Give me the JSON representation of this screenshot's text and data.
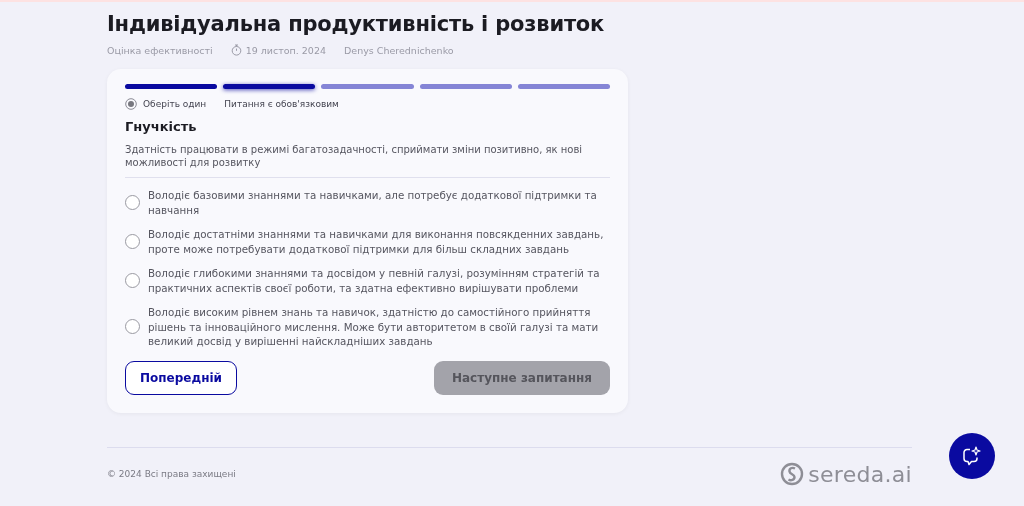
{
  "header": {
    "title": "Індивідуальна продуктивність і розвиток",
    "meta": {
      "category": "Оцінка ефективності",
      "date": "19 листоп. 2024",
      "author": "Denys Cherednichenko"
    }
  },
  "card": {
    "steps": [
      {
        "kind": "complete"
      },
      {
        "kind": "current"
      },
      {
        "kind": "upcoming"
      },
      {
        "kind": "upcoming"
      },
      {
        "kind": "upcoming"
      }
    ],
    "hint": "Оберіть один",
    "required_note": "Питання є обов'язковим",
    "question": {
      "title": "Гнучкість",
      "description": "Здатність працювати в режимі багатозадачності, сприймати зміни позитивно, як нові можливості для розвитку"
    },
    "options": [
      {
        "label": "Володіє базовими знаннями та навичками, але потребує додаткової підтримки та навчання",
        "selected": false
      },
      {
        "label": "Володіє достатніми знаннями та навичками для виконання повсякденних завдань, проте може потребувати додаткової підтримки для більш складних завдань",
        "selected": false
      },
      {
        "label": "Володіє глибокими знаннями та досвідом у певній галузі, розумінням стратегій та практичних аспектів своєї роботи, та здатна ефективно вирішувати проблеми",
        "selected": false
      },
      {
        "label": "Володіє високим рівнем знань та навичок, здатністю до самостійного прийняття рішень та інноваційного мислення. Може бути авторитетом в своїй галузі та мати великий досвід у вирішенні найскладніших завдань",
        "selected": false
      }
    ],
    "buttons": {
      "previous": {
        "label": "Попередній",
        "disabled": false
      },
      "next": {
        "label": "Наступне запитання",
        "disabled": true
      }
    }
  },
  "footer": {
    "copyright": "© 2024 Всі права захищені",
    "logo": "sereda.ai"
  }
}
